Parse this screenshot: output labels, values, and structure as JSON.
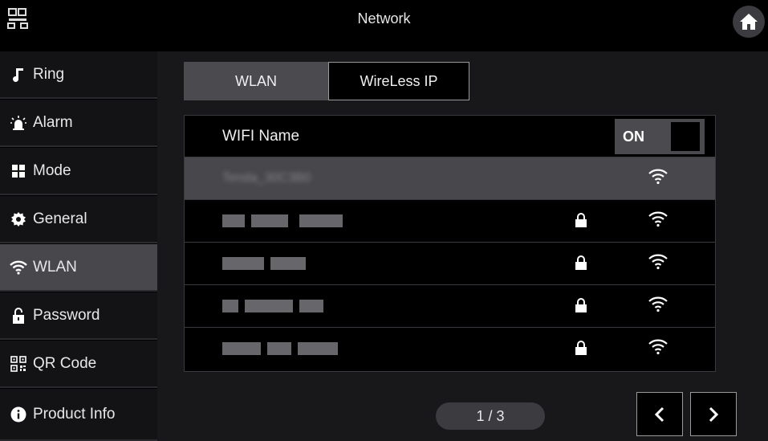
{
  "header": {
    "title": "Network"
  },
  "sidebar": {
    "items": [
      {
        "label": "Ring",
        "icon": "music-note-icon",
        "active": false
      },
      {
        "label": "Alarm",
        "icon": "alarm-siren-icon",
        "active": false
      },
      {
        "label": "Mode",
        "icon": "mode-grid-icon",
        "active": false
      },
      {
        "label": "General",
        "icon": "gear-icon",
        "active": false
      },
      {
        "label": "WLAN",
        "icon": "wifi-icon",
        "active": true
      },
      {
        "label": "Password",
        "icon": "unlock-icon",
        "active": false
      },
      {
        "label": "QR Code",
        "icon": "qr-code-icon",
        "active": false
      },
      {
        "label": "Product Info",
        "icon": "info-icon",
        "active": false
      }
    ]
  },
  "tabs": [
    {
      "label": "WLAN",
      "active": true
    },
    {
      "label": "WireLess IP",
      "active": false
    }
  ],
  "wifi_list": {
    "header_label": "WIFI Name",
    "toggle_label": "ON",
    "networks": [
      {
        "name": "Tenda_30C3B0",
        "locked": false,
        "selected": true
      },
      {
        "name": "",
        "locked": true,
        "selected": false
      },
      {
        "name": "",
        "locked": true,
        "selected": false
      },
      {
        "name": "",
        "locked": true,
        "selected": false
      },
      {
        "name": "",
        "locked": true,
        "selected": false
      }
    ]
  },
  "pagination": {
    "text": "1 / 3"
  },
  "colors": {
    "active_bg": "#47474c",
    "panel_bg": "#18181b",
    "accent_text": "#ffffff"
  }
}
